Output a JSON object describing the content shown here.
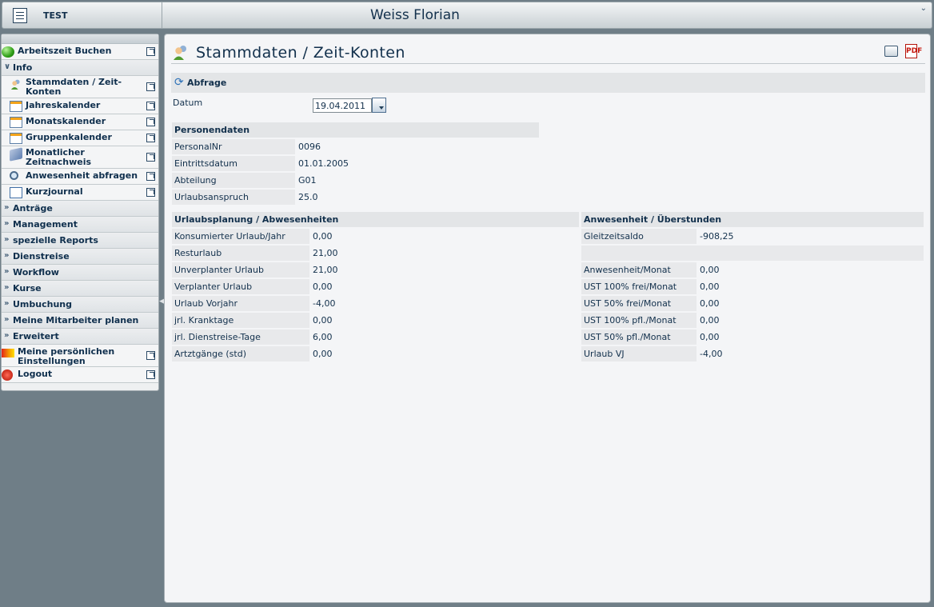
{
  "header": {
    "app_title": "TEST",
    "user_name": "Weiss Florian",
    "collapse_glyph": "⌄"
  },
  "sidebar": {
    "items": [
      {
        "label": "Arbeitszeit Buchen",
        "icon": "green-orb-icon"
      },
      {
        "label": "Info",
        "type": "section-open"
      },
      {
        "label": "Stammdaten / Zeit-Konten",
        "icon": "user-group-icon"
      },
      {
        "label": "Jahreskalender",
        "icon": "calendar-icon"
      },
      {
        "label": "Monatskalender",
        "icon": "calendar-icon"
      },
      {
        "label": "Gruppenkalender",
        "icon": "group-calendar-icon"
      },
      {
        "label": "Monatlicher Zeitnachweis",
        "icon": "book-icon"
      },
      {
        "label": "Anwesenheit abfragen",
        "icon": "search-user-icon"
      },
      {
        "label": "Kurzjournal",
        "icon": "list-icon"
      },
      {
        "label": "Anträge",
        "type": "section"
      },
      {
        "label": "Management",
        "type": "section"
      },
      {
        "label": "spezielle Reports",
        "type": "section"
      },
      {
        "label": "Dienstreise",
        "type": "section"
      },
      {
        "label": "Workflow",
        "type": "section"
      },
      {
        "label": "Kurse",
        "type": "section"
      },
      {
        "label": "Umbuchung",
        "type": "section"
      },
      {
        "label": "Meine Mitarbeiter planen",
        "type": "section"
      },
      {
        "label": "Erweitert",
        "type": "section"
      },
      {
        "label": "Meine persönlichen Einstellungen",
        "icon": "preferences-icon"
      },
      {
        "label": "Logout",
        "icon": "logout-icon"
      }
    ]
  },
  "page": {
    "title": "Stammdaten / Zeit-Konten",
    "pdf_label": "PDF"
  },
  "query": {
    "section_label": "Abfrage",
    "date_label": "Datum",
    "date_value": "19.04.2011"
  },
  "personendaten": {
    "header": "Personendaten",
    "rows": [
      {
        "key": "PersonalNr",
        "value": "0096"
      },
      {
        "key": "Eintrittsdatum",
        "value": "01.01.2005"
      },
      {
        "key": "Abteilung",
        "value": "G01"
      },
      {
        "key": "Urlaubsanspruch",
        "value": "25.0"
      }
    ]
  },
  "urlaub": {
    "header": "Urlaubsplanung / Abwesenheiten",
    "rows": [
      {
        "key": "Konsumierter Urlaub/Jahr",
        "value": "0,00"
      },
      {
        "key": "Resturlaub",
        "value": "21,00"
      },
      {
        "key": "Unverplanter Urlaub",
        "value": "21,00"
      },
      {
        "key": "Verplanter Urlaub",
        "value": "0,00"
      },
      {
        "key": "Urlaub Vorjahr",
        "value": "-4,00"
      },
      {
        "key": "jrl. Kranktage",
        "value": "0,00"
      },
      {
        "key": "jrl. Dienstreise-Tage",
        "value": "6,00"
      },
      {
        "key": "Artztgänge (std)",
        "value": "0,00"
      }
    ]
  },
  "anwesenheit": {
    "header": "Anwesenheit / Überstunden",
    "rows": [
      {
        "key": "Gleitzeitsaldo",
        "value": "-908,25"
      },
      {
        "key": "",
        "value": ""
      },
      {
        "key": "Anwesenheit/Monat",
        "value": "0,00"
      },
      {
        "key": "UST 100% frei/Monat",
        "value": "0,00"
      },
      {
        "key": "UST 50% frei/Monat",
        "value": "0,00"
      },
      {
        "key": "UST 100% pfl./Monat",
        "value": "0,00"
      },
      {
        "key": "UST 50% pfl./Monat",
        "value": "0,00"
      },
      {
        "key": "Urlaub VJ",
        "value": "-4,00"
      }
    ]
  }
}
